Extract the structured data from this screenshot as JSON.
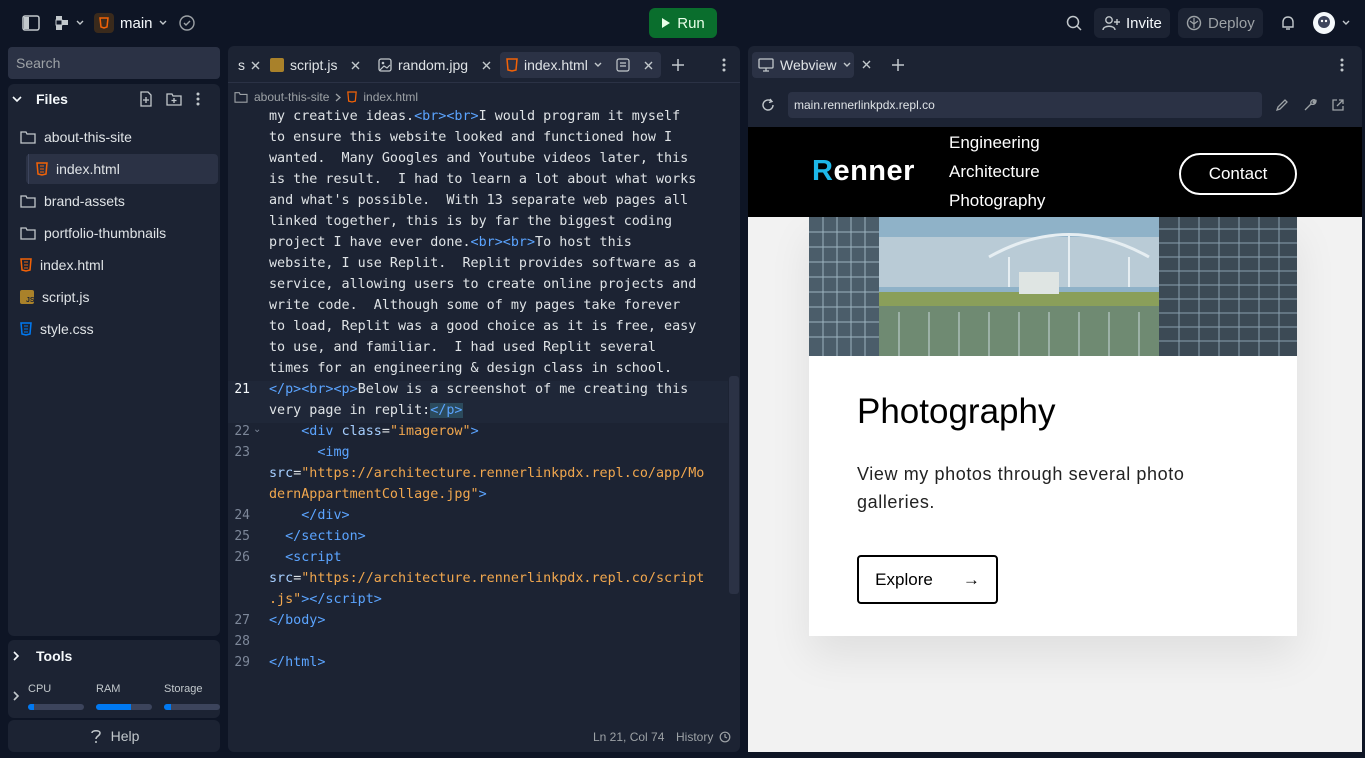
{
  "topbar": {
    "repl_name": "main",
    "run_label": "Run",
    "invite_label": "Invite",
    "deploy_label": "Deploy"
  },
  "sidebar": {
    "search_placeholder": "Search",
    "files_title": "Files",
    "tree": [
      {
        "label": "about-this-site",
        "type": "folder"
      },
      {
        "label": "index.html",
        "type": "html",
        "selected": true
      },
      {
        "label": "brand-assets",
        "type": "folder"
      },
      {
        "label": "portfolio-thumbnails",
        "type": "folder"
      },
      {
        "label": "index.html",
        "type": "html"
      },
      {
        "label": "script.js",
        "type": "js"
      },
      {
        "label": "style.css",
        "type": "css"
      }
    ],
    "tools_title": "Tools",
    "resources": [
      {
        "label": "CPU",
        "level": 0.1
      },
      {
        "label": "RAM",
        "level": 0.62
      },
      {
        "label": "Storage",
        "level": 0.12
      }
    ],
    "help_label": "Help"
  },
  "editor": {
    "tabs": [
      {
        "label": "s"
      },
      {
        "label": "script.js"
      },
      {
        "label": "random.jpg"
      },
      {
        "label": "index.html",
        "active": true
      }
    ],
    "breadcrumb": [
      "about-this-site",
      "index.html"
    ],
    "line_numbers": [
      "21",
      "22",
      "23",
      "24",
      "25",
      "26",
      "27",
      "28",
      "29"
    ],
    "prose_lines": [
      "my creative ideas.",
      "to ensure this website looked and functioned how I",
      "wanted.  Many Googles and Youtube videos later, this",
      "is the result.  I had to learn a lot about what works",
      "and what's possible.  With 13 separate web pages all",
      "linked together, this is by far the biggest coding",
      "project I have ever done.",
      "website, I use Replit.  Replit provides software as a",
      "service, allowing users to create online projects and",
      "write code.  Although some of my pages take forever",
      "to load, Replit was a good choice as it is free, easy",
      "to use, and familiar.  I had used Replit several",
      "times for an engineering & design class in school."
    ],
    "inline_text": {
      "l1_after": "I would program it myself",
      "l7_after": "To host this",
      "l21_a": "Below is a screenshot of me creating this",
      "l21_b": "very page in replit:",
      "l23_src": "\"https://architecture.rennerlinkpdx.repl.co/app/Mo",
      "l23_src2": "dernAppartmentCollage.jpg\"",
      "l26_src": "\"https://architecture.rennerlinkpdx.repl.co/script",
      "l26_src2": ".js\"",
      "imagerow": "\"imagerow\""
    },
    "status_position": "Ln 21, Col 74",
    "history_label": "History"
  },
  "webview": {
    "tab_label": "Webview",
    "url": "main.rennerlinkpdx.repl.co",
    "site": {
      "logo": "Renner",
      "nav": [
        "Engineering",
        "Architecture",
        "Photography"
      ],
      "contact_label": "Contact",
      "card_title": "Photography",
      "card_text": "View my photos through several photo galleries.",
      "explore_label": "Explore",
      "explore_arrow": "→"
    }
  },
  "colors": {
    "bg": "#0e1525",
    "panel": "#1c2333",
    "accent": "#0079f2",
    "run": "#0a6e2d",
    "html_icon": "#f26207",
    "js_icon": "#a9812a",
    "css_icon": "#0079f2"
  }
}
